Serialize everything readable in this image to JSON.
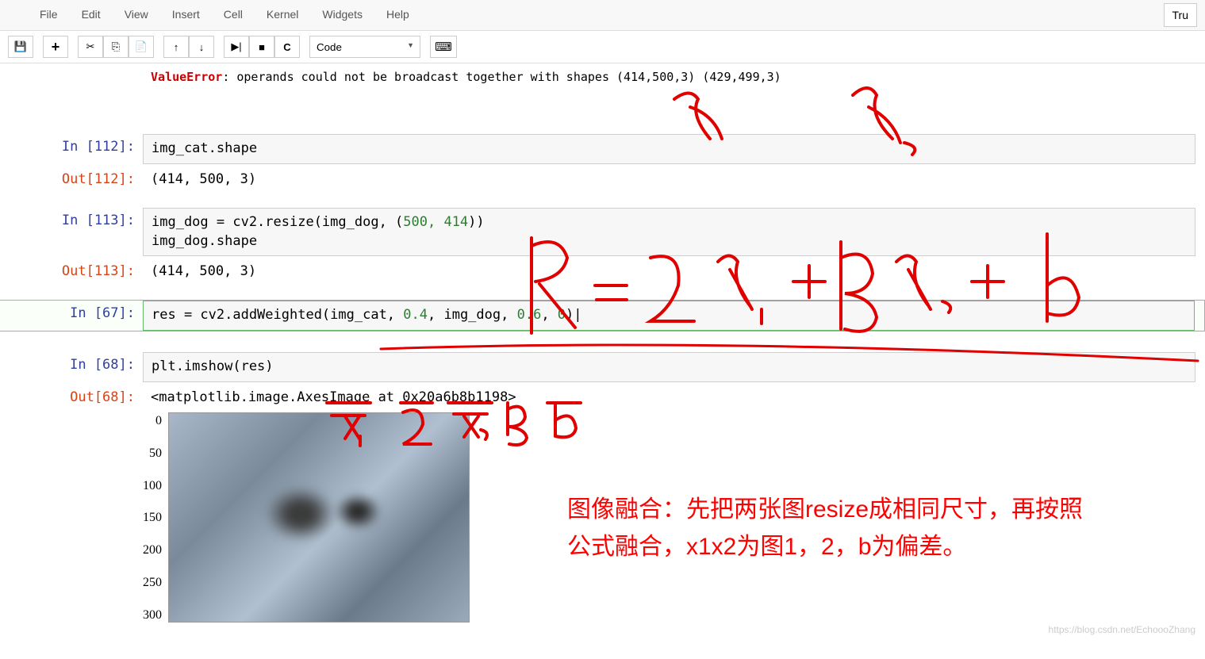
{
  "menubar": {
    "items": [
      "File",
      "Edit",
      "View",
      "Insert",
      "Cell",
      "Kernel",
      "Widgets",
      "Help"
    ],
    "kernel_indicator": "Tru"
  },
  "toolbar": {
    "save_icon": "💾",
    "add_icon": "+",
    "cut_icon": "✂",
    "copy_icon": "⎘",
    "paste_icon": "📄",
    "up_icon": "↑",
    "down_icon": "↓",
    "run_icon": "▶|",
    "stop_icon": "■",
    "restart_icon": "C",
    "cell_type": "Code",
    "cmd_icon": "⌨"
  },
  "error": {
    "name": "ValueError",
    "message": ": operands could not be broadcast together with shapes (414,500,3) (429,499,3)"
  },
  "cells": {
    "c112": {
      "in_label": "In [112]:",
      "code": "img_cat.shape",
      "out_label": "Out[112]:",
      "output": "(414, 500, 3)"
    },
    "c113": {
      "in_label": "In [113]:",
      "code_line1": "img_dog = cv2.resize(img_dog, (",
      "code_nums": "500, 414",
      "code_line1_end": "))",
      "code_line2": "img_dog.shape",
      "out_label": "Out[113]:",
      "output": "(414, 500, 3)"
    },
    "c67": {
      "in_label": "In [67]:",
      "code_a": "res = cv2.addWeighted(img_cat, ",
      "n1": "0.4",
      "sep1": ", img_dog, ",
      "n2": "0.6",
      "sep2": ", ",
      "n3": "0",
      "code_end": ")|"
    },
    "c68": {
      "in_label": "In [68]:",
      "code": "plt.imshow(res)",
      "out_label": "Out[68]:",
      "output": "<matplotlib.image.AxesImage at 0x20a6b8b1198>"
    }
  },
  "plot": {
    "y_ticks": [
      "0",
      "50",
      "100",
      "150",
      "200",
      "250",
      "300"
    ]
  },
  "annotations": {
    "chinese_text": "图像融合：先把两张图resize成相同尺寸，再按照公式融合，x1x2为图1，2，b为偏差。",
    "formula_top": "R = αX₁ + βX₂ + b",
    "formula_labels": "x₁ α x₂ β b",
    "x1_label": "X₁",
    "x2_label": "X₂"
  },
  "watermark": "https://blog.csdn.net/EchoooZhang"
}
